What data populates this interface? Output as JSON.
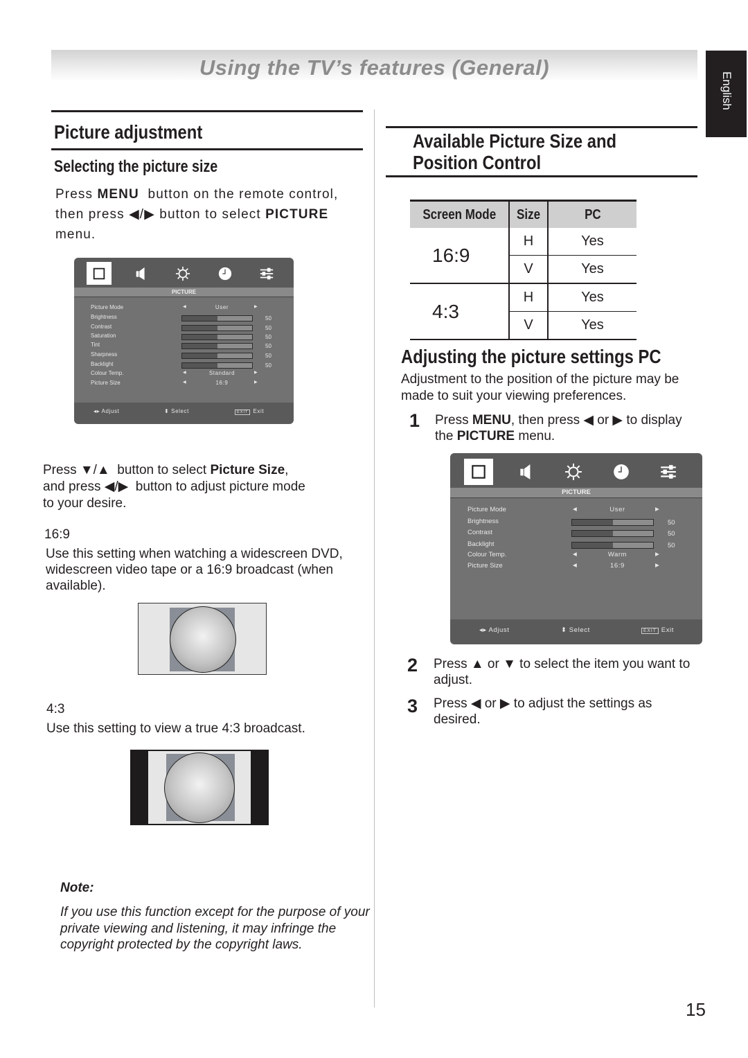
{
  "header": {
    "title": "Using the TV’s features (General)",
    "language_tab": "English"
  },
  "left": {
    "section_title": "Picture adjustment",
    "subsection_title": "Selecting the picture size",
    "intro": {
      "line1_pre": "Press ",
      "line1_bold": "MENU",
      "line1_post": "  button on the remote control,",
      "line2_pre": "then press ◀/▶ button to select ",
      "line2_bold": "PICTURE",
      "line3": "menu."
    },
    "osd_menu": {
      "tabs": [
        "picture-icon",
        "sound-icon",
        "setup-icon",
        "time-icon",
        "options-icon"
      ],
      "title": "PICTURE",
      "rows": [
        {
          "label": "Picture Mode",
          "type": "option",
          "value": "User"
        },
        {
          "label": "Brightness",
          "type": "slider",
          "value": 50
        },
        {
          "label": "Contrast",
          "type": "slider",
          "value": 50
        },
        {
          "label": "Saturation",
          "type": "slider",
          "value": 50
        },
        {
          "label": "Tint",
          "type": "slider",
          "value": 50
        },
        {
          "label": "Sharpness",
          "type": "slider",
          "value": 50
        },
        {
          "label": "Backlight",
          "type": "slider",
          "value": 50
        },
        {
          "label": "Colour Temp.",
          "type": "option",
          "value": "Standard"
        },
        {
          "label": "Picture Size",
          "type": "option",
          "value": "16:9"
        }
      ],
      "footer": {
        "adjust": "Adjust",
        "select": "Select",
        "exit_key": "EXIT",
        "exit": "Exit"
      }
    },
    "instructions": {
      "line1_pre": "Press ▼/▲  button to select ",
      "line1_bold": "Picture Size",
      "line1_post": ",",
      "line2": "and press ◀/▶  button to adjust picture mode",
      "line3": "to your desire."
    },
    "mode_169": {
      "label": "16:9",
      "desc": "Use this setting when watching a widescreen DVD, widescreen video tape or a 16:9 broadcast (when available)."
    },
    "mode_43": {
      "label": "4:3",
      "desc": "Use this setting to view a true 4:3 broadcast."
    },
    "note": {
      "title": "Note:",
      "body": "If you use this function except for the purpose of your private viewing and listening, it may infringe the copyright protected by the copyright laws."
    }
  },
  "right": {
    "section_title_line1": "Available Picture Size and",
    "section_title_line2": "Position Control",
    "table": {
      "headers": [
        "Screen Mode",
        "Size",
        "PC"
      ],
      "groups": [
        {
          "mode": "16:9",
          "rows": [
            {
              "size": "H",
              "pc": "Yes"
            },
            {
              "size": "V",
              "pc": "Yes"
            }
          ]
        },
        {
          "mode": "4:3",
          "rows": [
            {
              "size": "H",
              "pc": "Yes"
            },
            {
              "size": "V",
              "pc": "Yes"
            }
          ]
        }
      ]
    },
    "subsection_title": "Adjusting the picture settings PC",
    "intro": "Adjustment to the position of the picture may be made to suit your viewing preferences.",
    "steps": [
      {
        "num": "1",
        "pre": "Press ",
        "b1": "MENU",
        "mid": ", then press ◀ or ▶ to display",
        "line2_pre": "the ",
        "b2": "PICTURE",
        "line2_post": " menu."
      },
      {
        "num": "2",
        "text": "Press ▲ or ▼ to select the item you want to adjust."
      },
      {
        "num": "3",
        "text": "Press ◀ or ▶ to adjust the settings as desired."
      }
    ],
    "osd_menu": {
      "tabs": [
        "picture-icon",
        "sound-icon",
        "setup-icon",
        "time-icon",
        "options-icon"
      ],
      "title": "PICTURE",
      "rows": [
        {
          "label": "Picture Mode",
          "type": "option",
          "value": "User"
        },
        {
          "label": "Brightness",
          "type": "slider",
          "value": 50
        },
        {
          "label": "Contrast",
          "type": "slider",
          "value": 50
        },
        {
          "label": "Backlight",
          "type": "slider",
          "value": 50
        },
        {
          "label": "Colour Temp.",
          "type": "option",
          "value": "Warm"
        },
        {
          "label": "Picture Size",
          "type": "option",
          "value": "16:9"
        }
      ],
      "footer": {
        "adjust": "Adjust",
        "select": "Select",
        "exit_key": "EXIT",
        "exit": "Exit"
      }
    }
  },
  "page_number": "15"
}
